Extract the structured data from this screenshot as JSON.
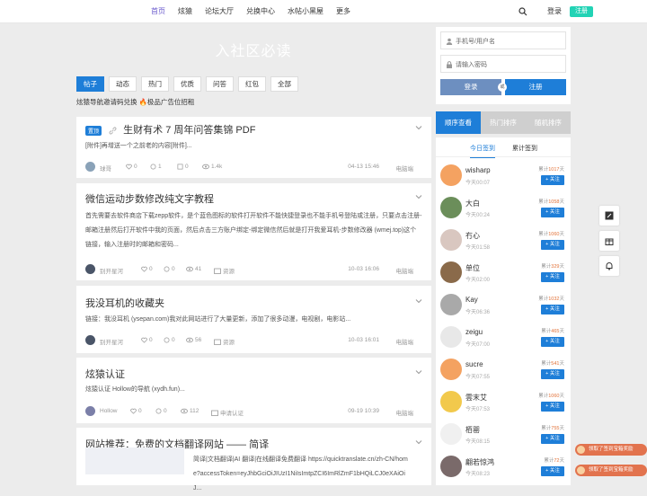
{
  "nav": {
    "items": [
      "首页",
      "炫猿",
      "论坛大厅",
      "兑换中心",
      "水帖小黑屋",
      "更多"
    ],
    "active": 0,
    "login": "登录",
    "register": "注册"
  },
  "banner": {
    "title": "入社区必读"
  },
  "tabs": {
    "items": [
      "帖子",
      "动态",
      "热门",
      "优质",
      "问答",
      "红包",
      "全部"
    ],
    "active": 0
  },
  "announce": "炫猿导航邀请码兑换 🔥极品广告位招租",
  "posts": [
    {
      "badge": "置顶",
      "title": "生财有术 7 周年问答集锦 PDF",
      "body": "[附件]再增送一个之前老的内容[附件]...",
      "author": "球哥",
      "likes": "0",
      "comments": "1",
      "edits": "0",
      "views": "1.4k",
      "time": "04-13 15:46",
      "device": "电脑端"
    },
    {
      "title": "微信运动步数修改纯文字教程",
      "body": "首先需要去软件商店下载zepp软件，是个蓝色图标的软件打开软件不能快捷登录也不能手机号登陆或注册，只要点击注册-邮箱注册然后打开软件中我的页面，然后点击三方账户绑定-绑定微信然后就是打开我爱耳机-步数修改器 (wmej.top)这个链接，输入注册时的邮箱和密码...",
      "author": "别开星河",
      "likes": "0",
      "comments": "0",
      "views": "41",
      "tag": "资源",
      "time": "10-03 16:06",
      "device": "电脑端"
    },
    {
      "title": "我没耳机的收藏夹",
      "body": "链接：我没耳机 (ysepan.com)我对此网站进行了大量更新，添加了很多动漫，电视剧，电影站...",
      "author": "别开星河",
      "likes": "0",
      "comments": "0",
      "views": "56",
      "tag": "资源",
      "time": "10-03 16:01",
      "device": "电脑端"
    },
    {
      "title": "炫猿认证",
      "body": "炫猿认证 Hollow的导航 (xydh.fun)...",
      "author": "Hollow",
      "likes": "0",
      "comments": "0",
      "views": "112",
      "tag": "申请认证",
      "time": "09-19 10:39",
      "device": "电脑端"
    },
    {
      "title": "网站推荐：免费的文档翻译网站 —— 简译",
      "body": "简译|文档翻译|AI 翻译|在线翻译免费翻译  https://quicktranslate.cn/zh-CN/home?accessToken=eyJhbGciOiJIUzI1NiIsImtpZCI6ImRlZmF1bHQiLCJ0eXAiOiJ..."
    }
  ],
  "login_box": {
    "user_placeholder": "手机号/用户名",
    "pwd_placeholder": "请输入密码",
    "login": "登录",
    "or": "或",
    "register": "注册"
  },
  "sort_tabs": {
    "items": [
      "顺序查看",
      "热门排序",
      "随机排序"
    ],
    "active": 0
  },
  "sign_tabs": {
    "items": [
      "今日签到",
      "累计签到"
    ],
    "active": 0
  },
  "total_prefix": "累计",
  "total_suffix": "天",
  "follow_label": "+ 关注",
  "signins": [
    {
      "name": "wisharp",
      "time": "今天00:07",
      "total": "1017",
      "color": "#f4a261"
    },
    {
      "name": "大白",
      "time": "今天00:24",
      "total": "1058",
      "color": "#6b8e5a"
    },
    {
      "name": "冇心",
      "time": "今天01:58",
      "total": "1060",
      "color": "#d9c7c0"
    },
    {
      "name": "单位",
      "time": "今天02:00",
      "total": "329",
      "color": "#8a6a4a"
    },
    {
      "name": "Kay",
      "time": "今天06:36",
      "total": "1032",
      "color": "#a9a9a9"
    },
    {
      "name": "zeigu",
      "time": "今天07:00",
      "total": "465",
      "color": "#e8e8e8"
    },
    {
      "name": "sucre",
      "time": "今天07:55",
      "total": "541",
      "color": "#f4a261"
    },
    {
      "name": "雲末艾",
      "time": "今天07:53",
      "total": "1060",
      "color": "#f2c94c"
    },
    {
      "name": "栢罂",
      "time": "今天08:15",
      "total": "755",
      "color": "#f0f0f0"
    },
    {
      "name": "翩若惊鸿",
      "time": "今天08:23",
      "total": "72",
      "color": "#7a6a6a"
    }
  ],
  "rewards": [
    "领取了签到宝箱奖励",
    "领取了签到宝箱奖励"
  ]
}
